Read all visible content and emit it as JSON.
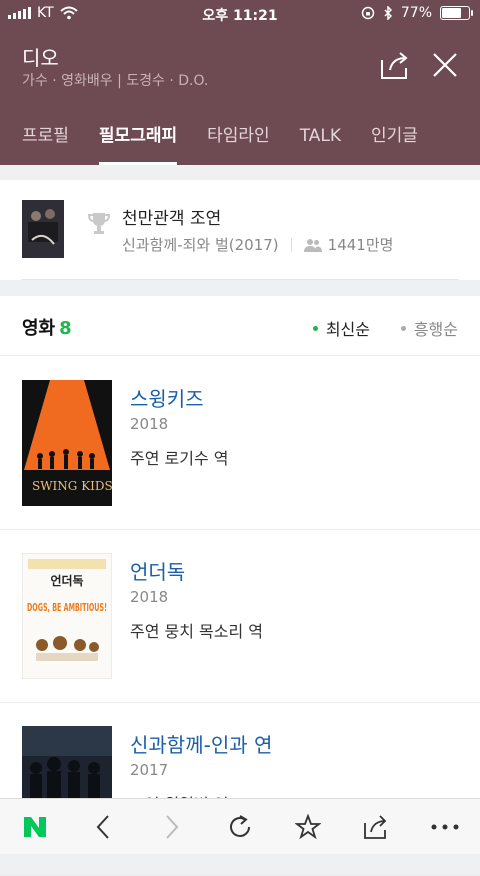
{
  "statusbar": {
    "carrier": "KT",
    "time": "오후 11:21",
    "battery": "77%",
    "battery_level": 0.77
  },
  "header": {
    "title": "디오",
    "subtitle": "가수 · 영화배우 | 도경수 · D.O."
  },
  "tabs": [
    {
      "label": "프로필",
      "active": false
    },
    {
      "label": "필모그래피",
      "active": true
    },
    {
      "label": "타임라인",
      "active": false
    },
    {
      "label": "TALK",
      "active": false
    },
    {
      "label": "인기글",
      "active": false
    }
  ],
  "highlight": {
    "title": "천만관객 조연",
    "movie": "신과함께-죄와 벌(2017)",
    "audience": "1441만명"
  },
  "section": {
    "label": "영화",
    "count": "8",
    "sort_latest": "최신순",
    "sort_hit": "흥행순"
  },
  "movies": [
    {
      "title": "스윙키즈",
      "year": "2018",
      "role": "주연 로기수 역",
      "poster_text": "SWING KIDS"
    },
    {
      "title": "언더독",
      "year": "2018",
      "role": "주연 뭉치 목소리 역",
      "poster_text": "DOGS, BE AMBITIOUS!"
    },
    {
      "title": "신과함께-인과 연",
      "year": "2017",
      "role": "조연 원일병 역",
      "poster_text": ""
    }
  ],
  "colors": {
    "brand": "#6e4b52",
    "link": "#1c5fa8",
    "accent_green": "#1fb64b",
    "naver_green": "#03c75a"
  },
  "icons": [
    "signal-icon",
    "wifi-icon",
    "bluetooth-icon",
    "share-icon",
    "close-icon",
    "trophy-icon",
    "people-icon",
    "naver-logo",
    "back-icon",
    "forward-icon",
    "refresh-icon",
    "bookmark-icon",
    "more-icon"
  ]
}
